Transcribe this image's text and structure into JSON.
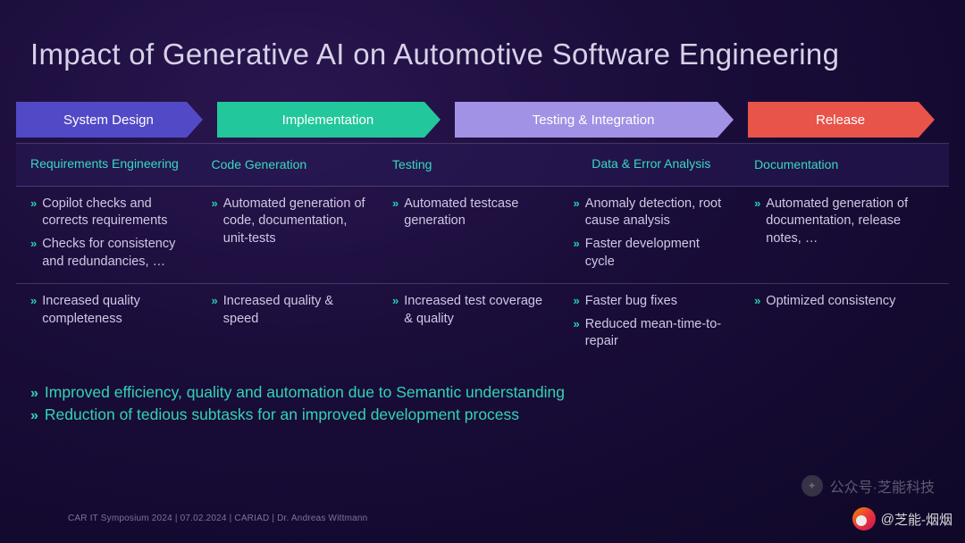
{
  "title": "Impact of Generative AI on Automotive Software Engineering",
  "phases": [
    {
      "label": "System Design"
    },
    {
      "label": "Implementation"
    },
    {
      "label": "Testing & Integration"
    },
    {
      "label": "Release"
    }
  ],
  "subheads": [
    "Requirements Engineering",
    "Code Generation",
    "Testing",
    "Data & Error Analysis",
    "Documentation"
  ],
  "detail_cells": [
    [
      "Copilot checks and corrects requirements",
      "Checks for consistency and redundancies, …"
    ],
    [
      "Automated generation of code, documentation, unit-tests"
    ],
    [
      "Automated testcase generation"
    ],
    [
      "Anomaly detection, root cause analysis",
      "Faster development cycle"
    ],
    [
      "Automated generation of documentation, release notes, …"
    ]
  ],
  "benefit_cells": [
    [
      "Increased quality completeness"
    ],
    [
      "Increased quality & speed"
    ],
    [
      "Increased test coverage & quality"
    ],
    [
      "Faster bug fixes",
      "Reduced mean-time-to-repair"
    ],
    [
      "Optimized consistency"
    ]
  ],
  "summary": [
    {
      "pre": "Improved efficiency, quality and automation due to ",
      "bold": "Semantic understanding"
    },
    {
      "pre": "Reduction of tedious subtasks for an improved development process",
      "bold": ""
    }
  ],
  "footer": "CAR IT Symposium 2024 | 07.02.2024 | CARIAD | Dr. Andreas Wittmann",
  "watermark_top": "公众号·芝能科技",
  "watermark_bottom_prefix": "@",
  "watermark_bottom": "芝能-烟烟"
}
